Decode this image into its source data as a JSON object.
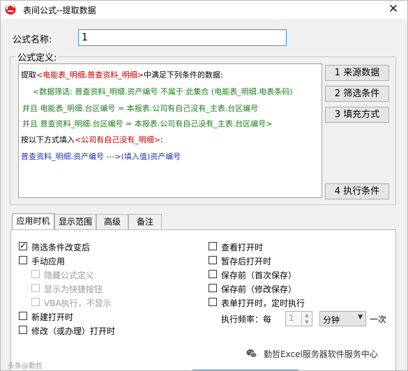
{
  "window": {
    "title": "表间公式--提取数据",
    "close_symbol": "✕",
    "app_icon": "excel-server-logo-icon",
    "accent_color": "#3f8fd6"
  },
  "form": {
    "name_label": "公式名称:",
    "name_value": "1",
    "definition_group_label": "公式定义:"
  },
  "formula": {
    "line1_prefix": "提取",
    "line1_source": "<电能表_明细,普查资料_明细>",
    "line1_suffix": "中满足下列条件的数据:",
    "line2": "<数据筛选: 普查资料_明细.资产编号 不属于  此集合 (电能表_明细.电表条码)",
    "line3": "并且 电能表_明细.台区编号 = 本报表.公司有自己没有_主表.台区编号",
    "line4": "并且 普查资料_明细.台区编号 = 本报表.公司有自己没有_主表.台区编号>",
    "line5_prefix": "按以下方式填入",
    "line5_target": "<公司有自己没有_明细>",
    "line5_suffix": ":",
    "line6": "普查资料_明细.资产编号  --->(填入值)资产编号"
  },
  "side_buttons": [
    {
      "label": "1  来源数据"
    },
    {
      "label": "2  筛选条件"
    },
    {
      "label": "3  填充方式"
    },
    {
      "label": "4  执行条件"
    }
  ],
  "tabs": [
    {
      "label": "应用时机",
      "active": true
    },
    {
      "label": "显示范围",
      "active": false
    },
    {
      "label": "高级",
      "active": false
    },
    {
      "label": "备注",
      "active": false
    }
  ],
  "options_left": [
    {
      "label": "筛选条件改变后",
      "checked": true,
      "disabled": false
    },
    {
      "label": "手动应用",
      "checked": false,
      "disabled": false
    },
    {
      "label": "隐藏公式定义",
      "checked": false,
      "disabled": true
    },
    {
      "label": "显示为快捷按钮",
      "checked": false,
      "disabled": true
    },
    {
      "label": "VBA执行，不显示",
      "checked": false,
      "disabled": true
    },
    {
      "label": "新建打开时",
      "checked": false,
      "disabled": false
    },
    {
      "label": "修改（或办理）打开时",
      "checked": false,
      "disabled": false
    }
  ],
  "options_right": [
    {
      "label": "查看打开时",
      "checked": false
    },
    {
      "label": "暂存后打开时",
      "checked": false
    },
    {
      "label": "保存前（首次保存）",
      "checked": false
    },
    {
      "label": "保存前（修改保存）",
      "checked": false
    },
    {
      "label": "表单打开时，定时执行",
      "checked": false
    }
  ],
  "frequency": {
    "label": "执行频率：每",
    "value": "1",
    "unit": "分钟",
    "suffix": "一次"
  },
  "watermark": {
    "icon": "wechat-icon",
    "text": "勤哲Excel服务器软件服务中心",
    "blurred": "头条@勤哲"
  }
}
